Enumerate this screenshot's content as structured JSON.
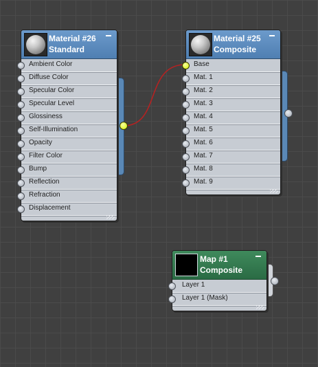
{
  "nodes": {
    "material26": {
      "title_line1": "Material #26",
      "title_line2": "Standard",
      "header_icon": "material-sphere-icon",
      "slots": [
        "Ambient Color",
        "Diffuse Color",
        "Specular Color",
        "Specular Level",
        "Glossiness",
        "Self-Illumination",
        "Opacity",
        "Filter Color",
        "Bump",
        "Reflection",
        "Refraction",
        "Displacement"
      ]
    },
    "material25": {
      "title_line1": "Material #25",
      "title_line2": "Composite",
      "header_icon": "material-sphere-icon",
      "slots": [
        "Base",
        "Mat. 1",
        "Mat. 2",
        "Mat. 3",
        "Mat. 4",
        "Mat. 5",
        "Mat. 6",
        "Mat. 7",
        "Mat. 8",
        "Mat. 9"
      ]
    },
    "map1": {
      "title_line1": "Map #1",
      "title_line2": "Composite",
      "header_icon": "map-black-swatch-icon",
      "slots": [
        "Layer 1",
        "Layer 1 (Mask)"
      ]
    }
  },
  "connections": [
    {
      "from": "Material #26 output",
      "to": "Material #25 Base",
      "color": "#b02020"
    }
  ],
  "colors": {
    "canvas": "#404040",
    "material_header": "#5a88bd",
    "map_header": "#2f7a4e",
    "active_socket": "#d4ee00"
  }
}
